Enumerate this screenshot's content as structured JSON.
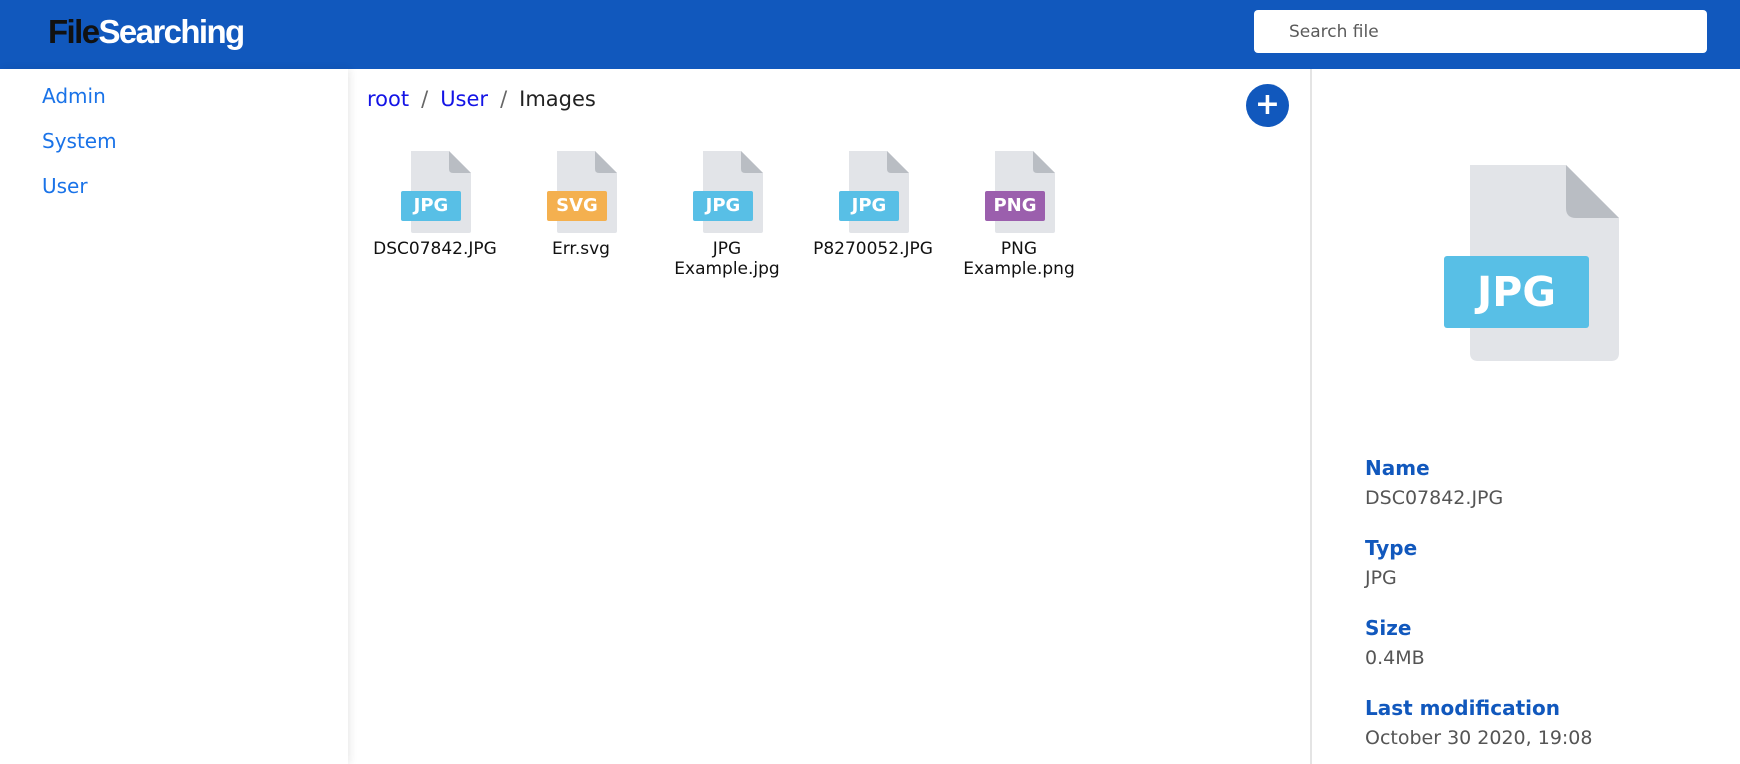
{
  "header": {
    "logo_part1": "File",
    "logo_part2": "Searching",
    "search_placeholder": "Search file"
  },
  "sidebar": {
    "items": [
      {
        "label": "Admin"
      },
      {
        "label": "System"
      },
      {
        "label": "User"
      }
    ]
  },
  "breadcrumb": {
    "items": [
      "root",
      "User"
    ],
    "current": "Images",
    "separator": "/"
  },
  "add_button": {
    "label": "+"
  },
  "files": [
    {
      "ext": "JPG",
      "name_line1": "DSC07842.JPG",
      "name_line2": "",
      "badge_color": "#58bfe6"
    },
    {
      "ext": "SVG",
      "name_line1": "Err.svg",
      "name_line2": "",
      "badge_color": "#f4b04f"
    },
    {
      "ext": "JPG",
      "name_line1": "JPG",
      "name_line2": "Example.jpg",
      "badge_color": "#58bfe6"
    },
    {
      "ext": "JPG",
      "name_line1": "P8270052.JPG",
      "name_line2": "",
      "badge_color": "#58bfe6"
    },
    {
      "ext": "PNG",
      "name_line1": "PNG",
      "name_line2": "Example.png",
      "badge_color": "#9b5fad"
    }
  ],
  "details": {
    "preview_ext": "JPG",
    "preview_color": "#58bfe6",
    "name_label": "Name",
    "name_value": "DSC07842.JPG",
    "type_label": "Type",
    "type_value": "JPG",
    "size_label": "Size",
    "size_value": "0.4MB",
    "modified_label": "Last modification",
    "modified_value": "October 30 2020, 19:08"
  },
  "colors": {
    "primary": "#1158bd",
    "link": "#1a73e8",
    "breadcrumb_link": "#1414e6"
  },
  "icons": {
    "file": "file-icon",
    "add": "plus-icon"
  }
}
